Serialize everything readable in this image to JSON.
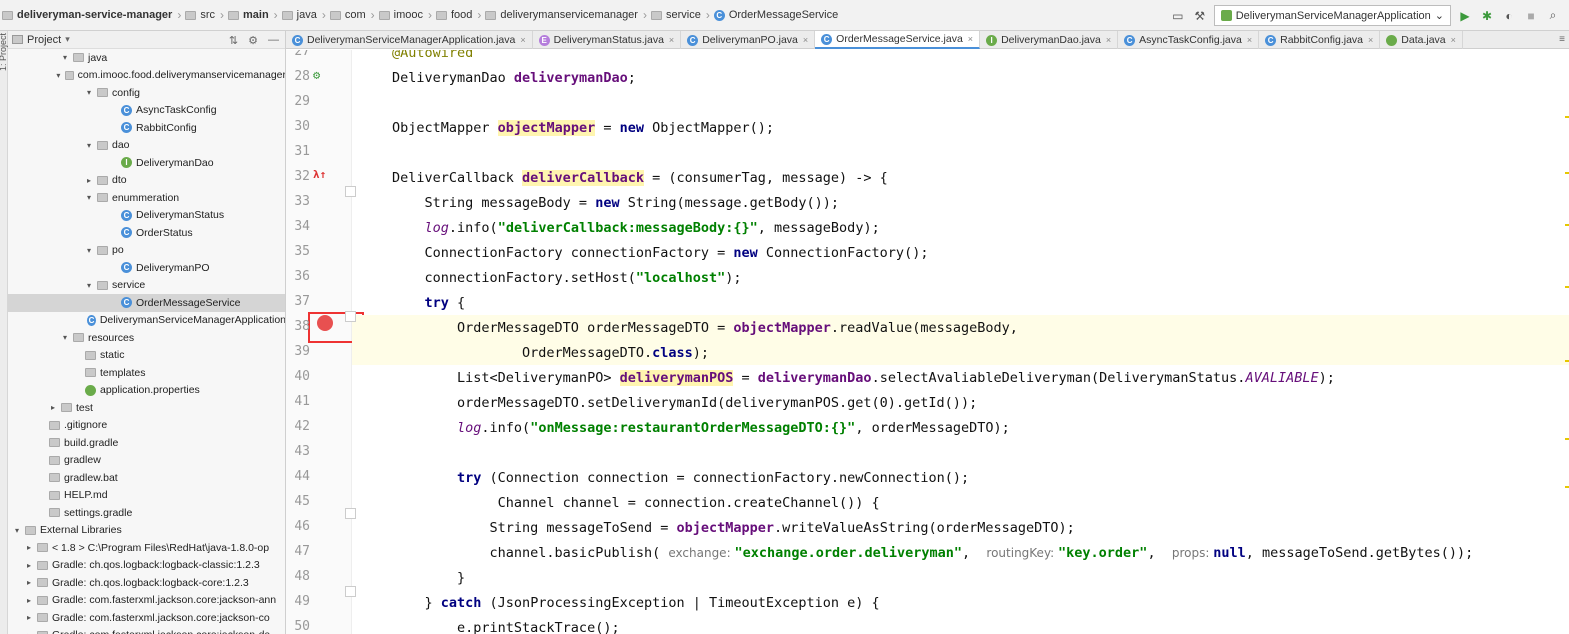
{
  "breadcrumbs": [
    {
      "label": "deliveryman-service-manager",
      "bold": true
    },
    {
      "label": "src"
    },
    {
      "label": "main",
      "bold": true
    },
    {
      "label": "java"
    },
    {
      "label": "com"
    },
    {
      "label": "imooc"
    },
    {
      "label": "food"
    },
    {
      "label": "deliverymanservicemanager"
    },
    {
      "label": "service"
    },
    {
      "label": "OrderMessageService"
    }
  ],
  "toolbar": {
    "run_config": "DeliverymanServiceManagerApplication",
    "icons": [
      "layout-icon",
      "hammer-icon",
      "run-icon",
      "debug-icon",
      "coverage-icon",
      "stop-icon",
      "search-icon"
    ]
  },
  "left_strip": {
    "label": "1: Project"
  },
  "project_panel": {
    "title": "Project",
    "tree": [
      {
        "label": "java",
        "indent": 4,
        "chev": "v",
        "icon": "folder"
      },
      {
        "label": "com.imooc.food.deliverymanservicemanager",
        "indent": 5,
        "chev": "v",
        "icon": "folder"
      },
      {
        "label": "config",
        "indent": 6,
        "chev": "v",
        "icon": "folder"
      },
      {
        "label": "AsyncTaskConfig",
        "indent": 8,
        "chev": "",
        "icon": "class"
      },
      {
        "label": "RabbitConfig",
        "indent": 8,
        "chev": "",
        "icon": "class"
      },
      {
        "label": "dao",
        "indent": 6,
        "chev": "v",
        "icon": "folder"
      },
      {
        "label": "DeliverymanDao",
        "indent": 8,
        "chev": "",
        "icon": "interface"
      },
      {
        "label": "dto",
        "indent": 6,
        "chev": ">",
        "icon": "folder"
      },
      {
        "label": "enummeration",
        "indent": 6,
        "chev": "v",
        "icon": "folder"
      },
      {
        "label": "DeliverymanStatus",
        "indent": 8,
        "chev": "",
        "icon": "class"
      },
      {
        "label": "OrderStatus",
        "indent": 8,
        "chev": "",
        "icon": "class"
      },
      {
        "label": "po",
        "indent": 6,
        "chev": "v",
        "icon": "folder"
      },
      {
        "label": "DeliverymanPO",
        "indent": 8,
        "chev": "",
        "icon": "class"
      },
      {
        "label": "service",
        "indent": 6,
        "chev": "v",
        "icon": "folder"
      },
      {
        "label": "OrderMessageService",
        "indent": 8,
        "chev": "",
        "icon": "class",
        "selected": true
      },
      {
        "label": "DeliverymanServiceManagerApplication",
        "indent": 7,
        "chev": "",
        "icon": "class"
      },
      {
        "label": "resources",
        "indent": 4,
        "chev": "v",
        "icon": "folder"
      },
      {
        "label": "static",
        "indent": 5,
        "chev": "",
        "icon": "folder"
      },
      {
        "label": "templates",
        "indent": 5,
        "chev": "",
        "icon": "folder"
      },
      {
        "label": "application.properties",
        "indent": 5,
        "chev": "",
        "icon": "props"
      },
      {
        "label": "test",
        "indent": 3,
        "chev": ">",
        "icon": "folder"
      },
      {
        "label": ".gitignore",
        "indent": 2,
        "chev": "",
        "icon": "file"
      },
      {
        "label": "build.gradle",
        "indent": 2,
        "chev": "",
        "icon": "file"
      },
      {
        "label": "gradlew",
        "indent": 2,
        "chev": "",
        "icon": "file"
      },
      {
        "label": "gradlew.bat",
        "indent": 2,
        "chev": "",
        "icon": "file"
      },
      {
        "label": "HELP.md",
        "indent": 2,
        "chev": "",
        "icon": "file"
      },
      {
        "label": "settings.gradle",
        "indent": 2,
        "chev": "",
        "icon": "file"
      },
      {
        "label": "External Libraries",
        "indent": 0,
        "chev": "v",
        "icon": "lib"
      },
      {
        "label": "< 1.8 >  C:\\Program Files\\RedHat\\java-1.8.0-op",
        "indent": 1,
        "chev": ">",
        "icon": "lib"
      },
      {
        "label": "Gradle: ch.qos.logback:logback-classic:1.2.3",
        "indent": 1,
        "chev": ">",
        "icon": "lib"
      },
      {
        "label": "Gradle: ch.qos.logback:logback-core:1.2.3",
        "indent": 1,
        "chev": ">",
        "icon": "lib"
      },
      {
        "label": "Gradle: com.fasterxml.jackson.core:jackson-ann",
        "indent": 1,
        "chev": ">",
        "icon": "lib"
      },
      {
        "label": "Gradle: com.fasterxml.jackson.core:jackson-co",
        "indent": 1,
        "chev": ">",
        "icon": "lib"
      },
      {
        "label": "Gradle: com.fasterxml.jackson.core:jackson-da",
        "indent": 1,
        "chev": ">",
        "icon": "lib"
      }
    ]
  },
  "tabs": [
    {
      "label": "DeliverymanServiceManagerApplication.java",
      "icon": "class"
    },
    {
      "label": "DeliverymanStatus.java",
      "icon": "enum"
    },
    {
      "label": "DeliverymanPO.java",
      "icon": "class"
    },
    {
      "label": "OrderMessageService.java",
      "icon": "class",
      "active": true
    },
    {
      "label": "DeliverymanDao.java",
      "icon": "interface"
    },
    {
      "label": "AsyncTaskConfig.java",
      "icon": "class"
    },
    {
      "label": "RabbitConfig.java",
      "icon": "class"
    },
    {
      "label": "Data.java",
      "icon": "data"
    }
  ],
  "editor": {
    "lines": [
      {
        "n": "27",
        "parts": [
          [
            "ann",
            "@Autowired"
          ]
        ]
      },
      {
        "n": "28",
        "parts": [
          [
            "",
            "DeliverymanDao "
          ],
          [
            "fld",
            "deliverymanDao"
          ],
          [
            "",
            ";"
          ]
        ]
      },
      {
        "n": "29",
        "parts": []
      },
      {
        "n": "30",
        "parts": [
          [
            "",
            "ObjectMapper "
          ],
          [
            "fld fld-hl",
            "objectMapper"
          ],
          [
            "",
            " = "
          ],
          [
            "kw",
            "new"
          ],
          [
            "",
            " ObjectMapper();"
          ]
        ]
      },
      {
        "n": "31",
        "parts": []
      },
      {
        "n": "32",
        "parts": [
          [
            "",
            "DeliverCallback "
          ],
          [
            "fld fld-hl",
            "deliverCallback"
          ],
          [
            "",
            " = (consumerTag, message) -> {"
          ]
        ]
      },
      {
        "n": "33",
        "parts": [
          [
            "",
            "    String messageBody = "
          ],
          [
            "kw",
            "new"
          ],
          [
            "",
            " String(message.getBody());"
          ]
        ]
      },
      {
        "n": "34",
        "parts": [
          [
            "",
            "    "
          ],
          [
            "it",
            "log"
          ],
          [
            "",
            ".info("
          ],
          [
            "str",
            "\"deliverCallback:messageBody:{}\""
          ],
          [
            "",
            ", messageBody);"
          ]
        ]
      },
      {
        "n": "35",
        "parts": [
          [
            "",
            "    ConnectionFactory connectionFactory = "
          ],
          [
            "kw",
            "new"
          ],
          [
            "",
            " ConnectionFactory();"
          ]
        ]
      },
      {
        "n": "36",
        "parts": [
          [
            "",
            "    connectionFactory.setHost("
          ],
          [
            "str",
            "\"localhost\""
          ],
          [
            "",
            ");"
          ]
        ]
      },
      {
        "n": "37",
        "parts": [
          [
            "",
            "    "
          ],
          [
            "kw",
            "try"
          ],
          [
            "",
            " {"
          ]
        ]
      },
      {
        "n": "38",
        "parts": [
          [
            "",
            "        OrderMessageDTO orderMessageDTO = "
          ],
          [
            "fld",
            "objectMapper"
          ],
          [
            "",
            ".readValue(messageBody,"
          ]
        ]
      },
      {
        "n": "39",
        "parts": [
          [
            "",
            "                OrderMessageDTO."
          ],
          [
            "kw",
            "class"
          ],
          [
            "",
            ");"
          ]
        ]
      },
      {
        "n": "40",
        "parts": [
          [
            "",
            "        List<DeliverymanPO> "
          ],
          [
            "fld fld-hl",
            "deliverymanPOS"
          ],
          [
            "",
            " = "
          ],
          [
            "fld",
            "deliverymanDao"
          ],
          [
            "",
            ".selectAvaliableDeliveryman(DeliverymanStatus."
          ],
          [
            "it",
            "AVALIABLE"
          ],
          [
            "",
            ");"
          ]
        ]
      },
      {
        "n": "41",
        "parts": [
          [
            "",
            "        orderMessageDTO.setDeliverymanId(deliverymanPOS.get(0).getId());"
          ]
        ]
      },
      {
        "n": "42",
        "parts": [
          [
            "",
            "        "
          ],
          [
            "it",
            "log"
          ],
          [
            "",
            ".info("
          ],
          [
            "str",
            "\"onMessage:restaurantOrderMessageDTO:{}\""
          ],
          [
            "",
            ", orderMessageDTO);"
          ]
        ]
      },
      {
        "n": "43",
        "parts": []
      },
      {
        "n": "44",
        "parts": [
          [
            "",
            "        "
          ],
          [
            "kw",
            "try"
          ],
          [
            "",
            " (Connection connection = connectionFactory.newConnection();"
          ]
        ]
      },
      {
        "n": "45",
        "parts": [
          [
            "",
            "             Channel channel = connection.createChannel()) {"
          ]
        ]
      },
      {
        "n": "46",
        "parts": [
          [
            "",
            "            String messageToSend = "
          ],
          [
            "fld",
            "objectMapper"
          ],
          [
            "",
            ".writeValueAsString(orderMessageDTO);"
          ]
        ]
      },
      {
        "n": "47",
        "parts": [
          [
            "",
            "            channel.basicPublish( "
          ],
          [
            "hint",
            "exchange: "
          ],
          [
            "str",
            "\"exchange.order.deliveryman\""
          ],
          [
            "",
            ",  "
          ],
          [
            "hint",
            "routingKey: "
          ],
          [
            "str",
            "\"key.order\""
          ],
          [
            "",
            ",  "
          ],
          [
            "hint",
            "props: "
          ],
          [
            "kw",
            "null"
          ],
          [
            "",
            ", messageToSend.getBytes());"
          ]
        ]
      },
      {
        "n": "48",
        "parts": [
          [
            "",
            "        }"
          ]
        ]
      },
      {
        "n": "49",
        "parts": [
          [
            "",
            "    } "
          ],
          [
            "kw",
            "catch"
          ],
          [
            "",
            " (JsonProcessingException | TimeoutException e) {"
          ]
        ]
      },
      {
        "n": "50",
        "parts": [
          [
            "",
            "        e.printStackTrace();"
          ]
        ]
      }
    ],
    "breakpoint_line": "38",
    "highlight_lines": [
      "38",
      "39"
    ]
  }
}
